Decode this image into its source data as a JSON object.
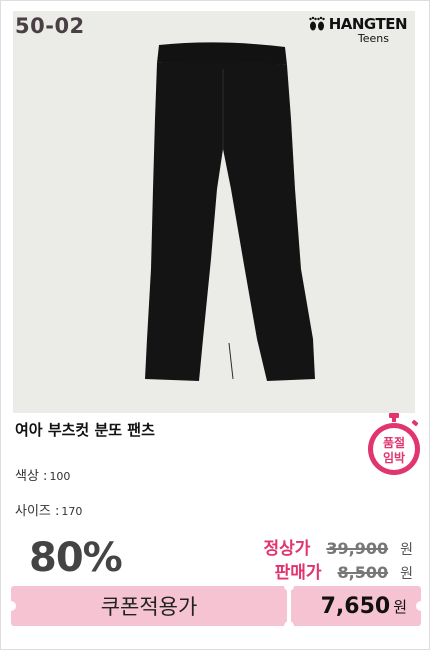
{
  "product": {
    "code": "50-02",
    "brand_name": "HANGTEN",
    "brand_sub": "Teens",
    "title": "여아 부츠컷 분또 팬츠",
    "badge_line1": "품절",
    "badge_line2": "임박"
  },
  "specs": {
    "color_label": "색상 :",
    "color_value": "100",
    "size_label": "사이즈 :",
    "size_value": "170"
  },
  "pricing": {
    "discount": "80%",
    "regular_label": "정상가",
    "regular_value": "39,900",
    "sale_label": "판매가",
    "sale_value": "8,500",
    "currency": "원"
  },
  "coupon": {
    "label": "쿠폰적용가",
    "price": "7,650",
    "currency": "원"
  },
  "colors": {
    "badge": "#e0356f",
    "coupon_bg": "#f6c3d3",
    "photo_bg": "#ebebe8"
  }
}
